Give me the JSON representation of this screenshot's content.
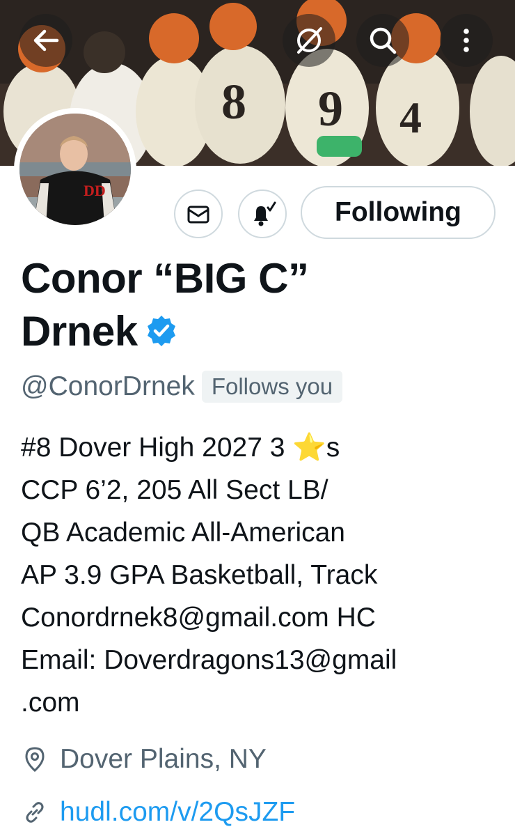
{
  "header": {
    "back_icon": "arrow-left-icon",
    "grok_icon": "slash-circle-icon",
    "search_icon": "search-icon",
    "more_icon": "more-vertical-icon",
    "banner_description": "football team banner photo"
  },
  "profile": {
    "name_line1": "Conor “BIG C”",
    "name_line2": "Drnek",
    "verified": true,
    "handle": "@ConorDrnek",
    "follows_you": "Follows you",
    "bio_line1": "#8 Dover High 2027 3 ⭐s",
    "bio_rest": "CCP 6’2, 205 All Sect LB/\nQB Academic All-American\nAP 3.9 GPA Basketball, Track\nConordrnek8@gmail.com HC\nEmail: Doverdragons13@gmail\n.com",
    "location": "Dover Plains, NY",
    "link": "hudl.com/v/2QsJZF"
  },
  "actions": {
    "message_icon": "envelope-icon",
    "notify_icon": "bell-check-icon",
    "follow_label": "Following"
  },
  "colors": {
    "accent": "#1d9bf0",
    "secondary_text": "#536471",
    "primary_text": "#0f1419",
    "border": "#cfd9de"
  }
}
